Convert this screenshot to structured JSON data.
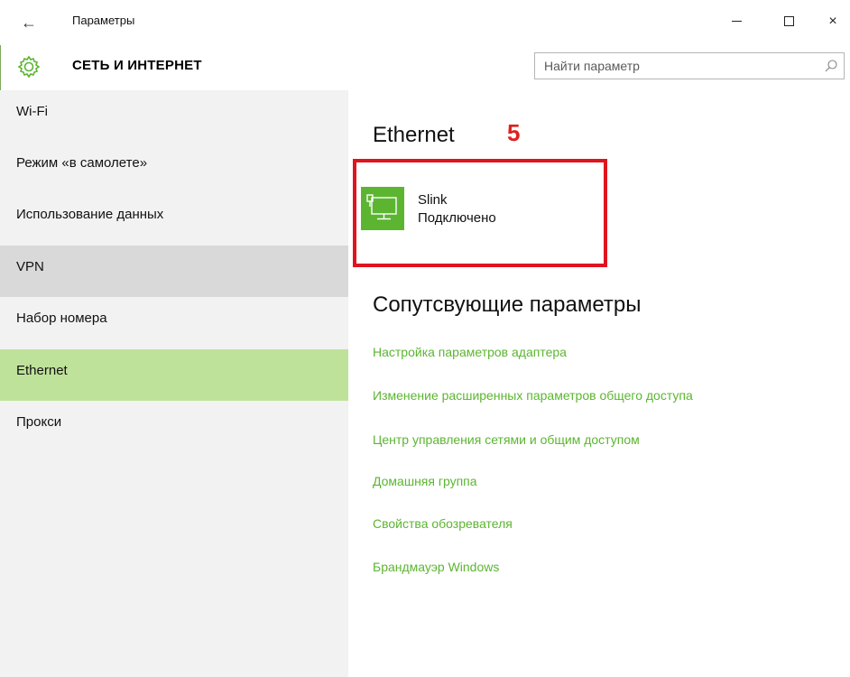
{
  "window": {
    "title": "Параметры",
    "back_icon": "arrow-left-icon",
    "min_icon": "minimize-icon",
    "max_icon": "maximize-icon",
    "close_glyph": "×"
  },
  "header": {
    "icon": "gear-icon",
    "title": "СЕТЬ И ИНТЕРНЕТ",
    "search": {
      "placeholder": "Найти параметр",
      "value": "",
      "icon": "search-icon"
    }
  },
  "sidebar": {
    "items": [
      {
        "label": "Wi-Fi",
        "state": "normal"
      },
      {
        "label": "Режим «в самолете»",
        "state": "normal"
      },
      {
        "label": "Использование данных",
        "state": "normal"
      },
      {
        "label": "VPN",
        "state": "hover"
      },
      {
        "label": "Набор номера",
        "state": "normal"
      },
      {
        "label": "Ethernet",
        "state": "selected"
      },
      {
        "label": "Прокси",
        "state": "normal"
      }
    ]
  },
  "main": {
    "heading": "Ethernet",
    "step_number": "5",
    "network": {
      "icon": "ethernet-monitor-icon",
      "name": "Slink",
      "status": "Подключено"
    },
    "related_heading": "Сопутсвующие параметры",
    "related_links": [
      "Настройка параметров адаптера",
      "Изменение расширенных параметров общего доступа",
      "Центр управления сетями и общим доступом",
      "Домашняя группа",
      "Свойства обозревателя",
      "Брандмауэр Windows"
    ]
  },
  "colors": {
    "accent_green": "#5cb531",
    "selected_bg": "#bfe29a",
    "hover_bg": "#d9d9d9",
    "sidebar_bg": "#f2f2f2",
    "highlight_red": "#e0141f"
  }
}
